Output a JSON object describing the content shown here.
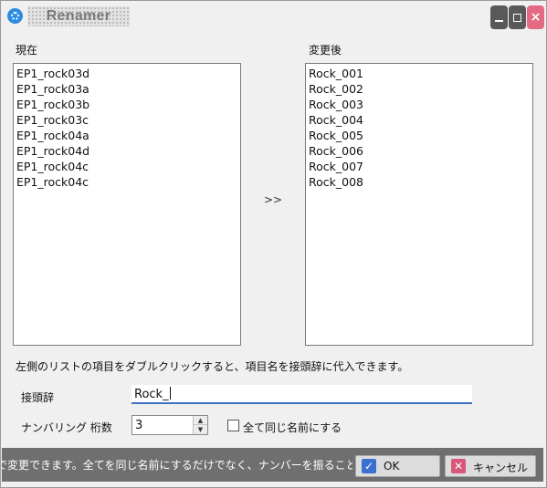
{
  "window": {
    "title": "Renamer",
    "controls": {
      "minimize_icon": "minimize-icon",
      "maximize_icon": "maximize-icon",
      "close_icon": "close-icon"
    }
  },
  "current": {
    "label": "現在",
    "items": [
      "EP1_rock03d",
      "EP1_rock03a",
      "EP1_rock03b",
      "EP1_rock03c",
      "EP1_rock04a",
      "EP1_rock04d",
      "EP1_rock04c",
      "EP1_rock04c"
    ]
  },
  "arrow": ">>",
  "after": {
    "label": "変更後",
    "items": [
      "Rock_001",
      "Rock_002",
      "Rock_003",
      "Rock_004",
      "Rock_005",
      "Rock_006",
      "Rock_007",
      "Rock_008"
    ]
  },
  "hint": "左側のリストの項目をダブルクリックすると、項目名を接頭辞に代入できます。",
  "prefix": {
    "label": "接頭辞",
    "value": "Rock_"
  },
  "numbering": {
    "label": "ナンバリング 桁数",
    "value": "3"
  },
  "same_name": {
    "label": "全て同じ名前にする",
    "checked": false
  },
  "status": {
    "text": "で変更できます。全てを同じ名前にするだけでなく、ナンバーを振ることもできます。"
  },
  "buttons": {
    "ok": "OK",
    "cancel": "キャンセル"
  },
  "colors": {
    "accent": "#3a6fd0",
    "close": "#e36a82",
    "statusbar": "#6f6f6f"
  }
}
